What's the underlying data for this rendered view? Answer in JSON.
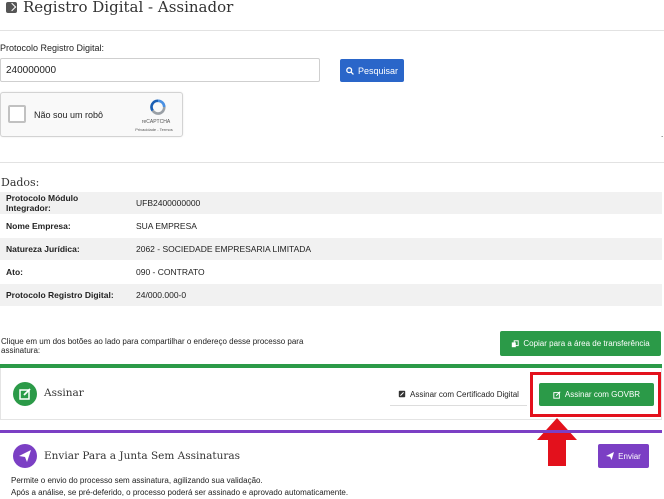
{
  "header": {
    "title": "Registro Digital - Assinador"
  },
  "search": {
    "label": "Protocolo Registro Digital:",
    "value": "240000000",
    "button_label": "Pesquisar"
  },
  "captcha": {
    "label": "Não sou um robô",
    "brand": "reCAPTCHA",
    "links": "Privacidade - Termos"
  },
  "dados": {
    "heading": "Dados:",
    "rows": [
      {
        "key": "Protocolo Módulo Integrador:",
        "value": "UFB2400000000"
      },
      {
        "key": "Nome Empresa:",
        "value": "SUA EMPRESA"
      },
      {
        "key": "Natureza Jurídica:",
        "value": "2062 - SOCIEDADE EMPRESARIA LIMITADA"
      },
      {
        "key": "Ato:",
        "value": "090 - CONTRATO"
      },
      {
        "key": "Protocolo Registro Digital:",
        "value": "24/000.000-0"
      }
    ]
  },
  "share": {
    "note": "Clique em um dos botões ao lado para compartilhar o endereço desse processo para assinatura:",
    "copy_label": "Copiar para a área de transferência"
  },
  "assinar": {
    "title": "Assinar",
    "cert_label": "Assinar com Certificado Digital",
    "govbr_label": "Assinar com GOVBR"
  },
  "enviar": {
    "title": "Enviar Para a Junta Sem Assinaturas",
    "line1": "Permite o envio do processo sem assinatura, agilizando sua validação.",
    "line2": "Após a análise, se pré-deferido, o processo poderá ser assinado e aprovado automaticamente.",
    "button_label": "Enviar"
  },
  "colors": {
    "primary": "#2a66c9",
    "success": "#2b9a48",
    "purple": "#7b3fc4",
    "highlight": "#e3111c"
  }
}
